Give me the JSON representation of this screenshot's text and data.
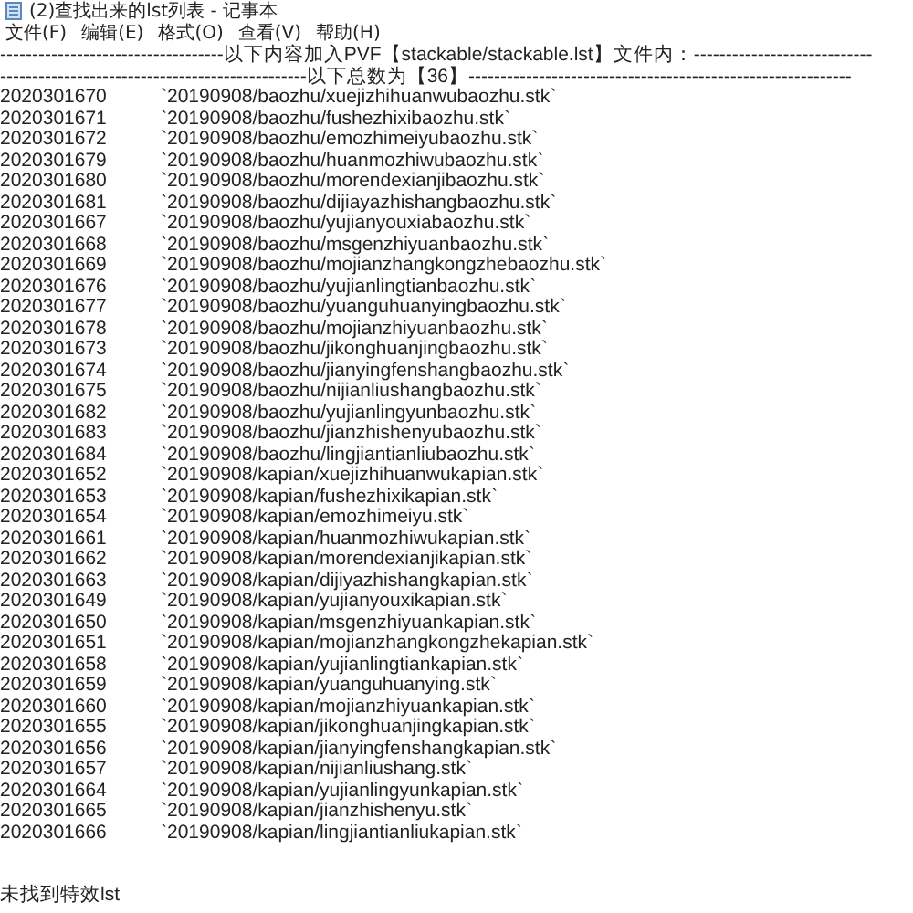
{
  "window": {
    "title": "(2)查找出来的lst列表 - 记事本"
  },
  "menu": [
    "文件(F)",
    "编辑(E)",
    "格式(O)",
    "查看(V)",
    "帮助(H)"
  ],
  "header_lines": [
    "-----------------------------------以下内容加入PVF【stackable/stackable.lst】文件内：----------------------------",
    "------------------------------------------------以下总数为【36】------------------------------------------------------------"
  ],
  "rows": [
    {
      "id": "2020301670",
      "path": "`20190908/baozhu/xuejizhihuanwubaozhu.stk`"
    },
    {
      "id": "2020301671",
      "path": "`20190908/baozhu/fushezhixibaozhu.stk`"
    },
    {
      "id": "2020301672",
      "path": "`20190908/baozhu/emozhimeiyubaozhu.stk`"
    },
    {
      "id": "2020301679",
      "path": "`20190908/baozhu/huanmozhiwubaozhu.stk`"
    },
    {
      "id": "2020301680",
      "path": "`20190908/baozhu/morendexianjibaozhu.stk`"
    },
    {
      "id": "2020301681",
      "path": "`20190908/baozhu/dijiayazhishangbaozhu.stk`"
    },
    {
      "id": "2020301667",
      "path": "`20190908/baozhu/yujianyouxiabaozhu.stk`"
    },
    {
      "id": "2020301668",
      "path": "`20190908/baozhu/msgenzhiyuanbaozhu.stk`"
    },
    {
      "id": "2020301669",
      "path": "`20190908/baozhu/mojianzhangkongzhebaozhu.stk`"
    },
    {
      "id": "2020301676",
      "path": "`20190908/baozhu/yujianlingtianbaozhu.stk`"
    },
    {
      "id": "2020301677",
      "path": "`20190908/baozhu/yuanguhuanyingbaozhu.stk`"
    },
    {
      "id": "2020301678",
      "path": "`20190908/baozhu/mojianzhiyuanbaozhu.stk`"
    },
    {
      "id": "2020301673",
      "path": "`20190908/baozhu/jikonghuanjingbaozhu.stk`"
    },
    {
      "id": "2020301674",
      "path": "`20190908/baozhu/jianyingfenshangbaozhu.stk`"
    },
    {
      "id": "2020301675",
      "path": "`20190908/baozhu/nijianliushangbaozhu.stk`"
    },
    {
      "id": "2020301682",
      "path": "`20190908/baozhu/yujianlingyunbaozhu.stk`"
    },
    {
      "id": "2020301683",
      "path": "`20190908/baozhu/jianzhishenyubaozhu.stk`"
    },
    {
      "id": "2020301684",
      "path": "`20190908/baozhu/lingjiantianliubaozhu.stk`"
    },
    {
      "id": "2020301652",
      "path": "`20190908/kapian/xuejizhihuanwukapian.stk`"
    },
    {
      "id": "2020301653",
      "path": "`20190908/kapian/fushezhixikapian.stk`"
    },
    {
      "id": "2020301654",
      "path": "`20190908/kapian/emozhimeiyu.stk`"
    },
    {
      "id": "2020301661",
      "path": "`20190908/kapian/huanmozhiwukapian.stk`"
    },
    {
      "id": "2020301662",
      "path": "`20190908/kapian/morendexianjikapian.stk`"
    },
    {
      "id": "2020301663",
      "path": "`20190908/kapian/dijiyazhishangkapian.stk`"
    },
    {
      "id": "2020301649",
      "path": "`20190908/kapian/yujianyouxikapian.stk`"
    },
    {
      "id": "2020301650",
      "path": "`20190908/kapian/msgenzhiyuankapian.stk`"
    },
    {
      "id": "2020301651",
      "path": "`20190908/kapian/mojianzhangkongzhekapian.stk`"
    },
    {
      "id": "2020301658",
      "path": "`20190908/kapian/yujianlingtiankapian.stk`"
    },
    {
      "id": "2020301659",
      "path": "`20190908/kapian/yuanguhuanying.stk`"
    },
    {
      "id": "2020301660",
      "path": "`20190908/kapian/mojianzhiyuankapian.stk`"
    },
    {
      "id": "2020301655",
      "path": "`20190908/kapian/jikonghuanjingkapian.stk`"
    },
    {
      "id": "2020301656",
      "path": "`20190908/kapian/jianyingfenshangkapian.stk`"
    },
    {
      "id": "2020301657",
      "path": "`20190908/kapian/nijianliushang.stk`"
    },
    {
      "id": "2020301664",
      "path": "`20190908/kapian/yujianlingyunkapian.stk`"
    },
    {
      "id": "2020301665",
      "path": "`20190908/kapian/jianzhishenyu.stk`"
    },
    {
      "id": "2020301666",
      "path": "`20190908/kapian/lingjiantianliukapian.stk`"
    }
  ],
  "footer": "未找到特效lst"
}
